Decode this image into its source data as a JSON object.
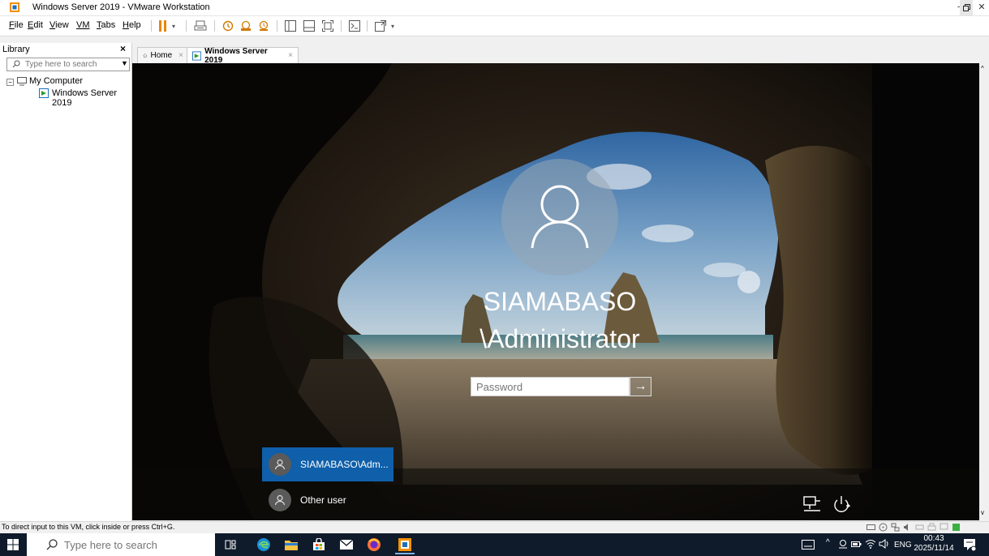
{
  "window": {
    "title": "Windows Server 2019 - VMware Workstation"
  },
  "menu": [
    {
      "mn": "F",
      "rest": "ile"
    },
    {
      "mn": "E",
      "rest": "dit"
    },
    {
      "mn": "V",
      "rest": "iew"
    },
    {
      "mn": "VM",
      "rest": ""
    },
    {
      "mn": "T",
      "rest": "abs"
    },
    {
      "mn": "H",
      "rest": "elp"
    }
  ],
  "library": {
    "title": "Library",
    "search_placeholder": "Type here to search",
    "tree": {
      "root": "My Computer",
      "child": "Windows Server 2019"
    }
  },
  "tabs": [
    {
      "label": "Home"
    },
    {
      "label": "Windows Server 2019"
    }
  ],
  "login": {
    "name_line1": "SIAMABASO",
    "name_line2": "\\Administrator",
    "password_placeholder": "Password",
    "submit_glyph": "→",
    "users": [
      {
        "label": "SIAMABASO\\Adm..."
      },
      {
        "label": "Other user"
      }
    ]
  },
  "status": {
    "text": "To direct input to this VM, click inside or press Ctrl+G."
  },
  "taskbar": {
    "search_placeholder": "Type here to search",
    "tray": {
      "lang": "ENG",
      "time": "00:43",
      "date": "2025/11/14"
    }
  },
  "colors": {
    "selection_blue": "#0f5faa",
    "taskbar": "#0f1b2b",
    "accent_orange": "#e8850c"
  }
}
